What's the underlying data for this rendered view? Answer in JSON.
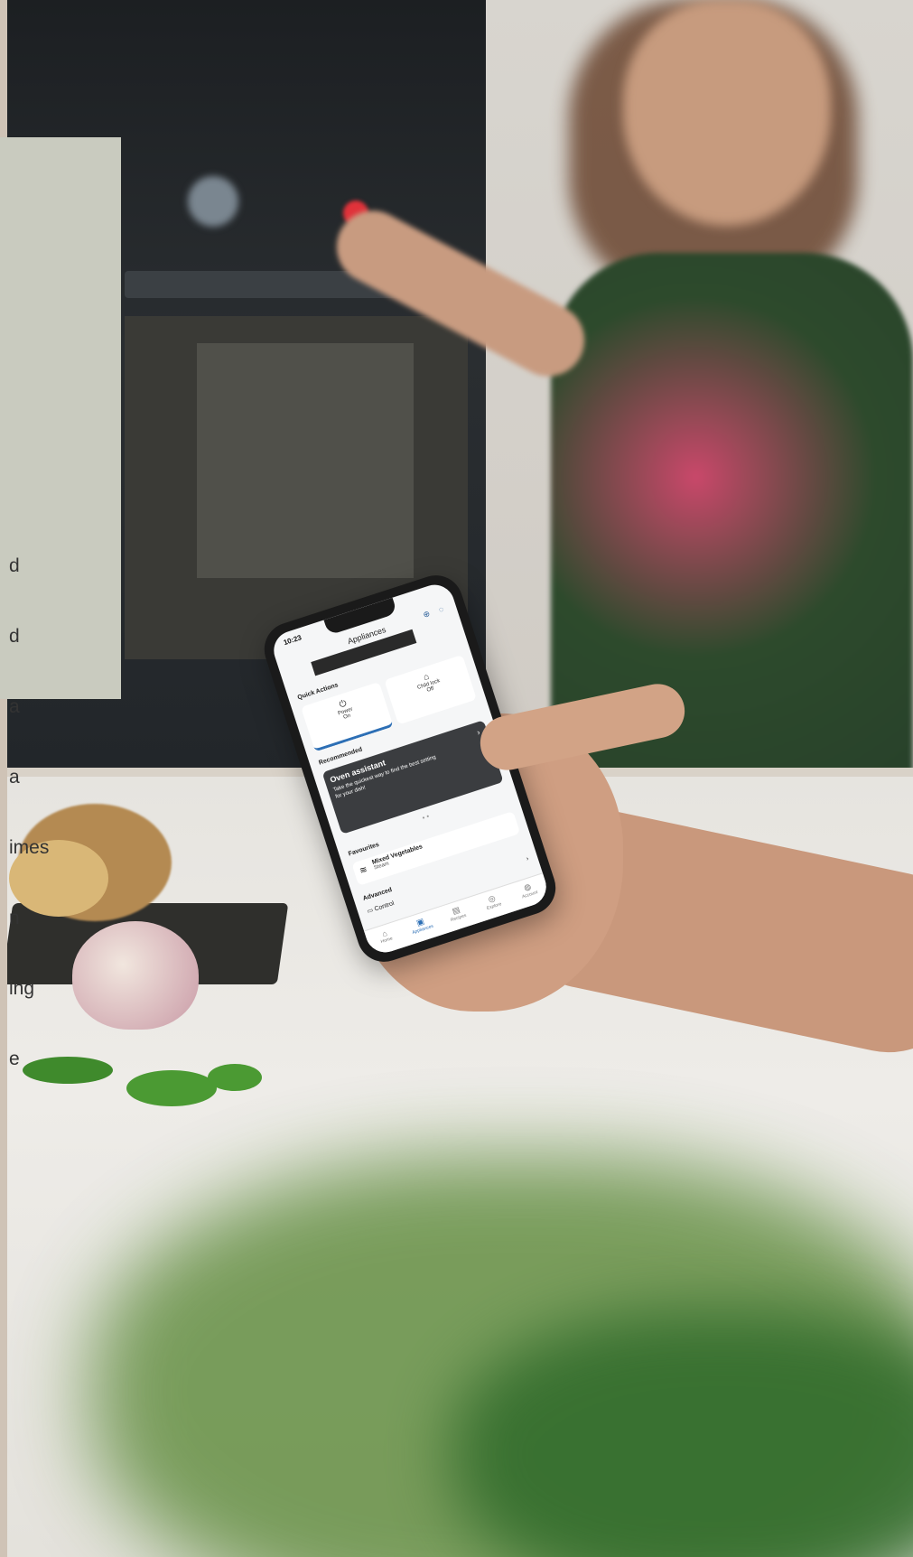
{
  "overlay_panel": {
    "lines": [
      "d",
      "d",
      "a",
      "a",
      "imes",
      "n",
      "ing",
      "e"
    ]
  },
  "phone": {
    "status_time": "10:23",
    "app_title": "Appliances",
    "sections": {
      "quick_actions": "Quick Actions",
      "recommended": "Recommended",
      "favourites": "Favourites",
      "advanced": "Advanced"
    },
    "quick_actions": [
      {
        "label": "Power",
        "value": "On",
        "icon": "power-icon"
      },
      {
        "label": "Child lock",
        "value": "Off",
        "icon": "lock-icon"
      }
    ],
    "recommended_card": {
      "title": "Oven assistant",
      "description": "Take the quickest way to find the best setting for your dish!"
    },
    "favourite": {
      "name": "Mixed Vegetables",
      "subtitle": "Steam",
      "icon": "steam-icon"
    },
    "advanced_item": "Control",
    "tabs": [
      {
        "label": "Home",
        "icon": "home-icon"
      },
      {
        "label": "Appliances",
        "icon": "oven-icon",
        "active": true
      },
      {
        "label": "Recipes",
        "icon": "recipes-icon"
      },
      {
        "label": "Explore",
        "icon": "explore-icon"
      },
      {
        "label": "Account",
        "icon": "account-icon"
      }
    ],
    "accent_color": "#2d6fb5"
  }
}
